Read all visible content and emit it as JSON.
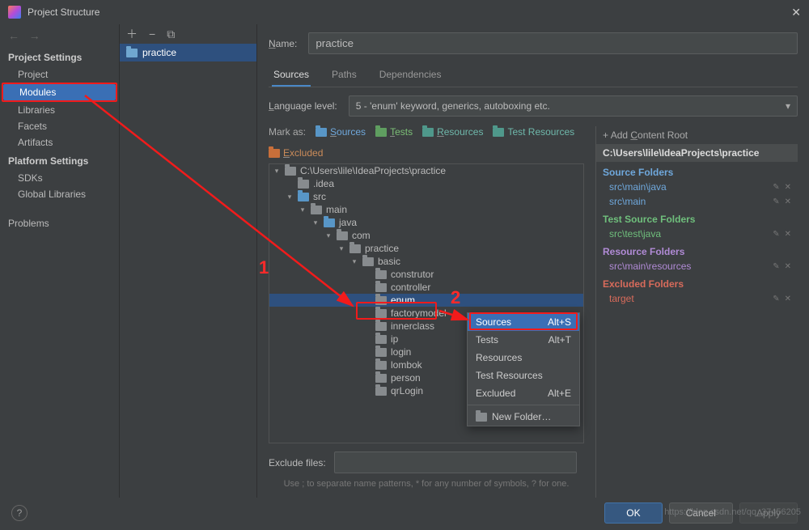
{
  "window": {
    "title": "Project Structure"
  },
  "leftnav": {
    "sections": [
      {
        "title": "Project Settings",
        "items": [
          "Project",
          "Modules",
          "Libraries",
          "Facets",
          "Artifacts"
        ],
        "selected": 1
      },
      {
        "title": "Platform Settings",
        "items": [
          "SDKs",
          "Global Libraries"
        ]
      }
    ],
    "problems": "Problems"
  },
  "modlist": {
    "module": "practice"
  },
  "form": {
    "name_label": "Name:",
    "name_value": "practice",
    "tabs": [
      "Sources",
      "Paths",
      "Dependencies"
    ],
    "active_tab": 0,
    "lang_label": "Language level:",
    "lang_value": "5 - 'enum' keyword, generics, autoboxing etc.",
    "markas_label": "Mark as:",
    "markas": [
      {
        "label": "Sources",
        "cls": "blue"
      },
      {
        "label": "Tests",
        "cls": "green"
      },
      {
        "label": "Resources",
        "cls": "teal"
      },
      {
        "label": "Test Resources",
        "cls": "teal2"
      },
      {
        "label": "Excluded",
        "cls": "orange"
      }
    ],
    "exclude_label": "Exclude files:",
    "hint": "Use ; to separate name patterns, * for any number of symbols, ? for one."
  },
  "tree": {
    "root": "C:\\Users\\lile\\IdeaProjects\\practice",
    "idea": ".idea",
    "src": "src",
    "main": "main",
    "java": "java",
    "com": "com",
    "practice": "practice",
    "basic": "basic",
    "children": [
      "construtor",
      "controller",
      "enum",
      "factorymodel",
      "innerclass",
      "ip",
      "login",
      "lombok",
      "person",
      "qrLogin"
    ],
    "selected_index": 2
  },
  "ctx": {
    "items": [
      {
        "label": "Sources",
        "shortcut": "Alt+S"
      },
      {
        "label": "Tests",
        "shortcut": "Alt+T"
      },
      {
        "label": "Resources",
        "shortcut": ""
      },
      {
        "label": "Test Resources",
        "shortcut": ""
      },
      {
        "label": "Excluded",
        "shortcut": "Alt+E"
      }
    ],
    "new_folder": "New Folder…"
  },
  "roots": {
    "add": "Add Content Root",
    "root": "C:\\Users\\lile\\IdeaProjects\\practice",
    "cats": [
      {
        "title": "Source Folders",
        "cls": "src",
        "items": [
          "src\\main\\java",
          "src\\main"
        ]
      },
      {
        "title": "Test Source Folders",
        "cls": "test",
        "items": [
          "src\\test\\java"
        ]
      },
      {
        "title": "Resource Folders",
        "cls": "res",
        "items": [
          "src\\main\\resources"
        ]
      },
      {
        "title": "Excluded Folders",
        "cls": "exc",
        "items": [
          "target"
        ]
      }
    ]
  },
  "buttons": {
    "ok": "OK",
    "cancel": "Cancel",
    "apply": "Apply"
  },
  "annotations": {
    "n1": "1",
    "n2": "2"
  },
  "watermark": "https://blog.csdn.net/qq_37456205"
}
